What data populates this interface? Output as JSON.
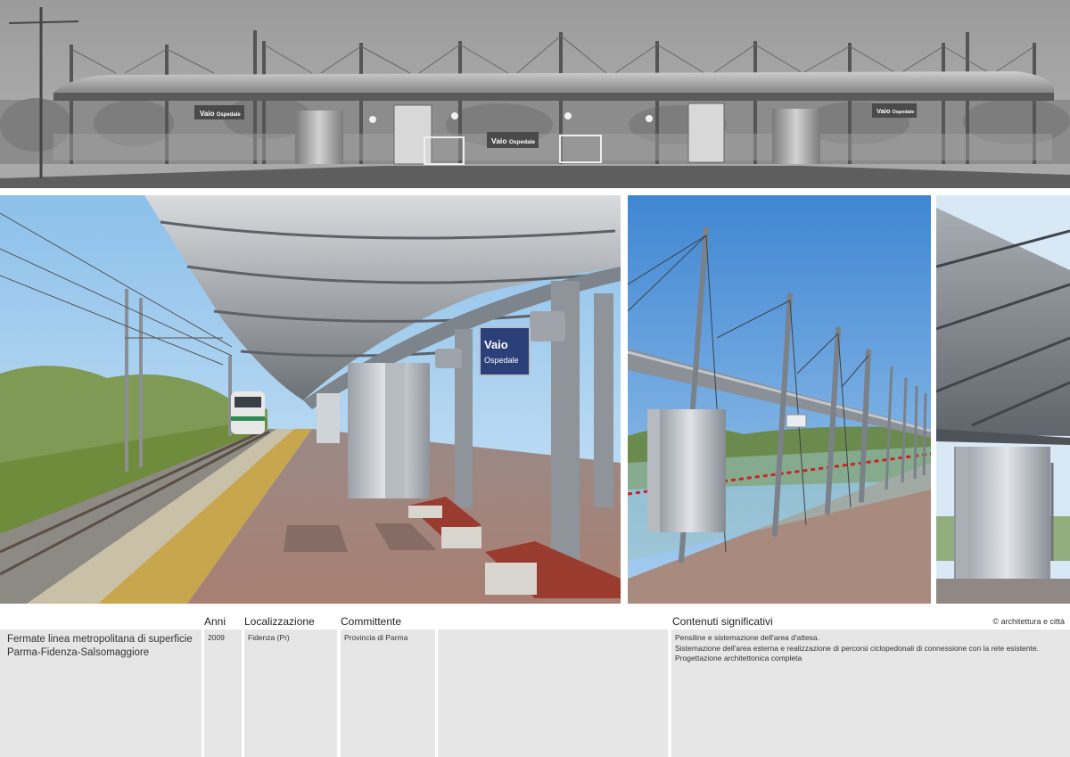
{
  "project": {
    "title_line1": "Fermate linea metropolitana di superficie",
    "title_line2": "Parma-Fidenza-Salsomaggiore"
  },
  "credit": "© architettura e città",
  "columns": {
    "anni": {
      "header": "Anni",
      "value": "2009"
    },
    "localizzazione": {
      "header": "Localizzazione",
      "value": "Fidenza (Pr)"
    },
    "committente": {
      "header": "Committente",
      "value": "Provincia di Parma"
    },
    "contenuti": {
      "header": "Contenuti significativi",
      "lines": [
        "Pensiline e sistemazione dell'area d'attesa.",
        "Sistemazione dell'area esterna e realizzazione di percorsi ciclopedonali di connessione con la rete esistente.",
        "Progettazione architettonica completa"
      ]
    }
  },
  "signs": {
    "station_name": "Vaio",
    "station_suffix": "Ospedale"
  },
  "colors": {
    "sky": "#8cc0ea",
    "brick": "#a87f72",
    "grass": "#6f8b3c",
    "steel": "#9aa0a6",
    "panel": "#e6e6e6"
  }
}
